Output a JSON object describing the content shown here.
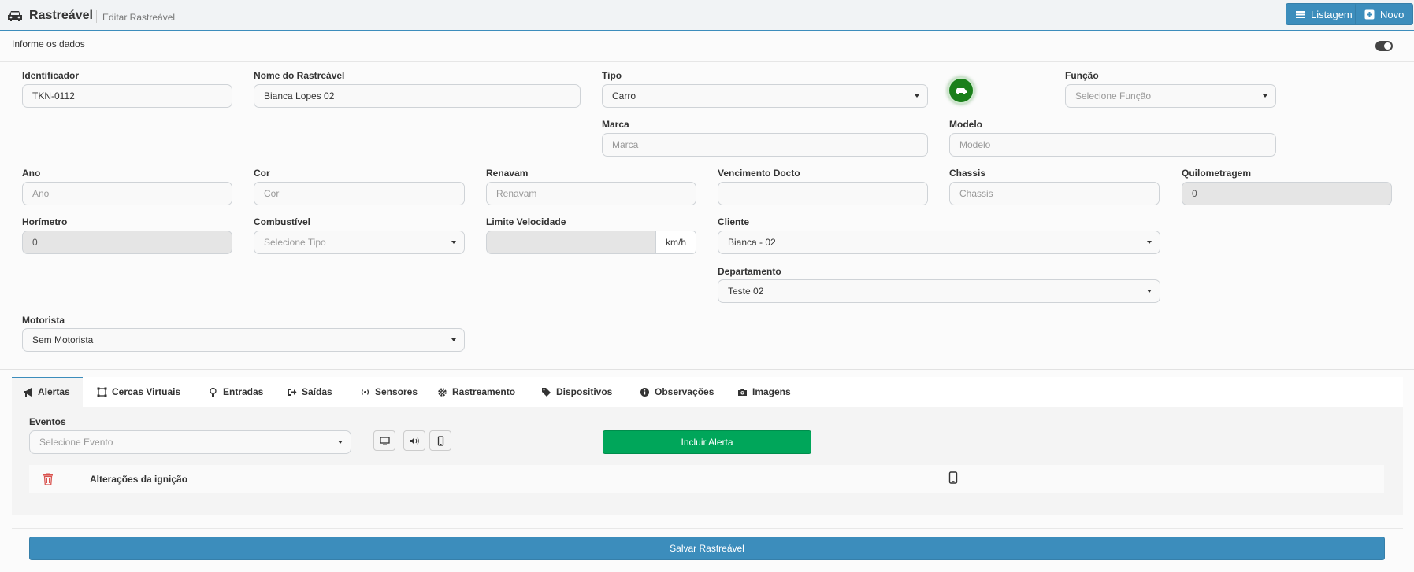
{
  "header": {
    "title": "Rastreável",
    "subtitle": "Editar Rastreável",
    "listagem_label": "Listagem",
    "novo_label": "Novo",
    "accent": "#3c8dbc"
  },
  "panel": {
    "heading": "Informe os dados"
  },
  "form": {
    "identificador": {
      "label": "Identificador",
      "value": "TKN-0112"
    },
    "nome": {
      "label": "Nome do Rastreável",
      "value": "Bianca Lopes 02"
    },
    "tipo": {
      "label": "Tipo",
      "value": "Carro"
    },
    "funcao": {
      "label": "Função",
      "value": "Selecione Função"
    },
    "marca": {
      "label": "Marca",
      "placeholder": "Marca"
    },
    "modelo": {
      "label": "Modelo",
      "placeholder": "Modelo"
    },
    "ano": {
      "label": "Ano",
      "placeholder": "Ano"
    },
    "cor": {
      "label": "Cor",
      "placeholder": "Cor"
    },
    "renavam": {
      "label": "Renavam",
      "placeholder": "Renavam"
    },
    "vencimento": {
      "label": "Vencimento Docto",
      "value": ""
    },
    "chassis": {
      "label": "Chassis",
      "placeholder": "Chassis"
    },
    "quilometragem": {
      "label": "Quilometragem",
      "value": "0"
    },
    "horimetro": {
      "label": "Horímetro",
      "value": "0"
    },
    "combustivel": {
      "label": "Combustível",
      "value": "Selecione Tipo"
    },
    "limite": {
      "label": "Limite Velocidade",
      "value": "",
      "unit": "km/h"
    },
    "cliente": {
      "label": "Cliente",
      "value": "Bianca - 02"
    },
    "departamento": {
      "label": "Departamento",
      "value": "Teste 02"
    },
    "motorista": {
      "label": "Motorista",
      "value": "Sem Motorista"
    }
  },
  "tabs": [
    {
      "label": "Alertas",
      "icon": "bullhorn-icon"
    },
    {
      "label": "Cercas Virtuais",
      "icon": "fence-icon"
    },
    {
      "label": "Entradas",
      "icon": "lightbulb-icon"
    },
    {
      "label": "Saídas",
      "icon": "sign-out-icon"
    },
    {
      "label": "Sensores",
      "icon": "broadcast-icon"
    },
    {
      "label": "Rastreamento",
      "icon": "gear-icon"
    },
    {
      "label": "Dispositivos",
      "icon": "tags-icon"
    },
    {
      "label": "Observações",
      "icon": "info-icon"
    },
    {
      "label": "Imagens",
      "icon": "camera-icon"
    }
  ],
  "alertas": {
    "eventos_label": "Eventos",
    "evento_select": "Selecione Evento",
    "incluir_label": "Incluir Alerta",
    "rows": [
      {
        "name": "Alterações da ignição"
      }
    ]
  },
  "footer": {
    "save_label": "Salvar Rastreável"
  }
}
